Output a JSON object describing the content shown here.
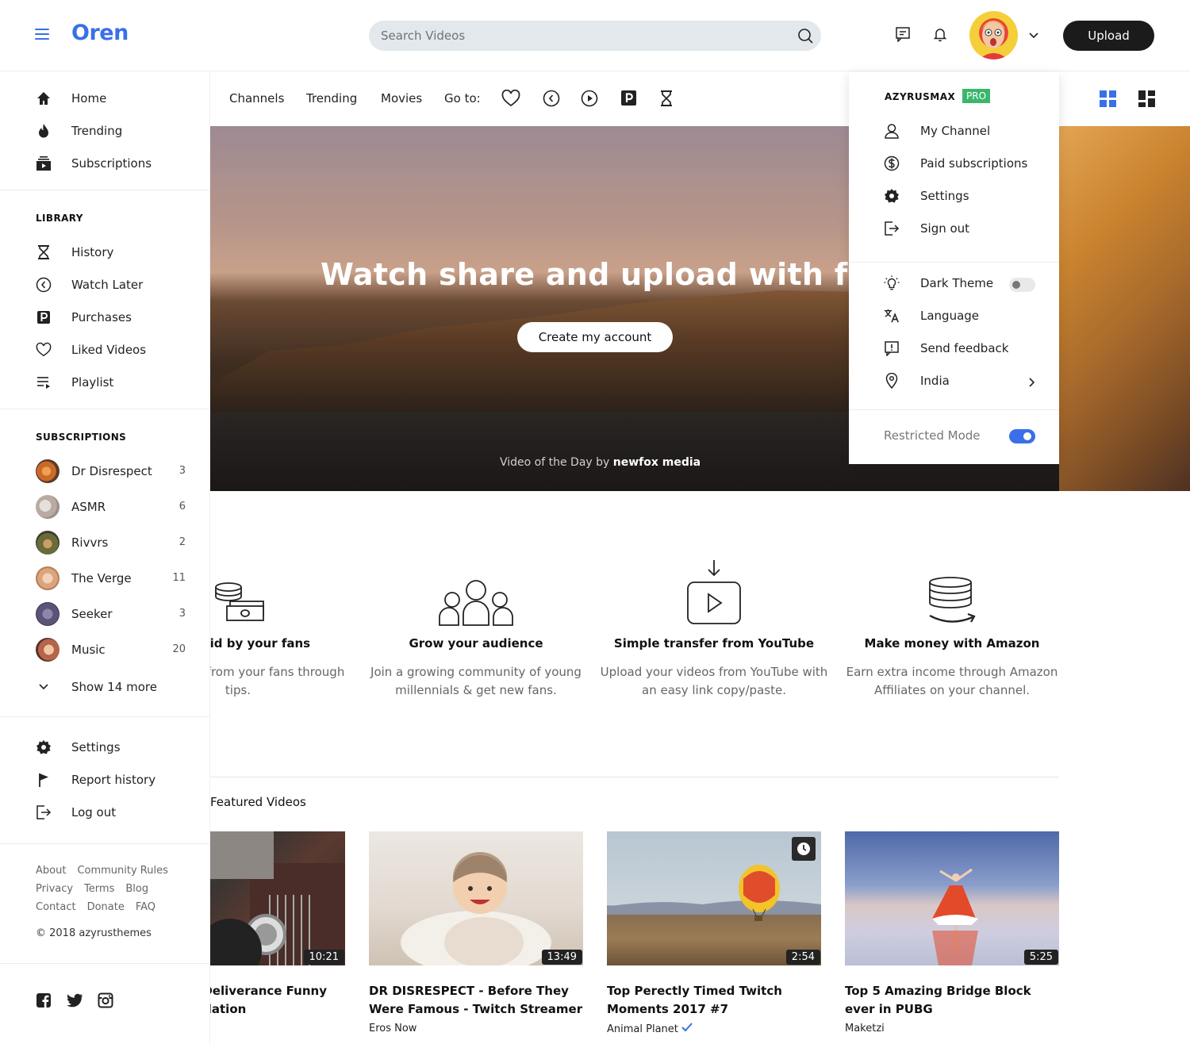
{
  "app": {
    "logo": "Oren"
  },
  "header": {
    "search_placeholder": "Search Videos",
    "upload_label": "Upload"
  },
  "colors": {
    "accent": "#3a6fe8",
    "pro_badge": "#3bb76d",
    "dark_button": "#1b1b1b"
  },
  "sidebar": {
    "main": [
      {
        "label": "Home",
        "icon": "home-icon"
      },
      {
        "label": "Trending",
        "icon": "fire-icon"
      },
      {
        "label": "Subscriptions",
        "icon": "subscriptions-icon"
      }
    ],
    "library_heading": "LIBRARY",
    "library": [
      {
        "label": "History",
        "icon": "hourglass-icon"
      },
      {
        "label": "Watch Later",
        "icon": "clock-back-icon"
      },
      {
        "label": "Purchases",
        "icon": "p-badge-icon"
      },
      {
        "label": "Liked Videos",
        "icon": "heart-icon"
      },
      {
        "label": "Playlist",
        "icon": "playlist-icon"
      }
    ],
    "subscriptions_heading": "SUBSCRIPTIONS",
    "subscriptions": [
      {
        "name": "Dr Disrespect",
        "count": "3"
      },
      {
        "name": "ASMR",
        "count": "6"
      },
      {
        "name": "Rivvrs",
        "count": "2"
      },
      {
        "name": "The Verge",
        "count": "11"
      },
      {
        "name": "Seeker",
        "count": "3"
      },
      {
        "name": "Music",
        "count": "20"
      }
    ],
    "show_more": "Show 14 more",
    "bottom": [
      {
        "label": "Settings",
        "icon": "gear-icon"
      },
      {
        "label": "Report history",
        "icon": "flag-icon"
      },
      {
        "label": "Log out",
        "icon": "logout-icon"
      }
    ],
    "footer_links": [
      [
        "About",
        "Community Rules"
      ],
      [
        "Privacy",
        "Terms",
        "Blog"
      ],
      [
        "Contact",
        "Donate",
        "FAQ"
      ]
    ],
    "copyright": "© 2018 azyrusthemes"
  },
  "nav": {
    "links": [
      "Channels",
      "Trending",
      "Movies"
    ],
    "goto_label": "Go to:"
  },
  "hero": {
    "title": "Watch share and upload with friends",
    "button": "Create my account",
    "credit_prefix": "Video of the Day by",
    "credit_name": "newfox media"
  },
  "features": [
    {
      "title": "Get paid by your fans",
      "desc": "Earn money from your fans through tips."
    },
    {
      "title": "Grow your audience",
      "desc": "Join a growing community of young millennials & get new fans."
    },
    {
      "title": "Simple transfer from YouTube",
      "desc": "Upload your videos from YouTube with an easy link copy/paste."
    },
    {
      "title": "Make money with Amazon",
      "desc": "Earn extra income through Amazon Affiliates on your channel."
    }
  ],
  "section_title": "Featured Videos",
  "videos": [
    {
      "title": "Dirt Rally: Deliverance Funny Fails Compilation",
      "channel": "",
      "duration": "10:21"
    },
    {
      "title": "DR DISRESPECT - Before They Were Famous - Twitch Streamer",
      "channel": "Eros Now",
      "duration": "13:49"
    },
    {
      "title": "Top Perectly Timed Twitch Moments 2017 #7",
      "channel": "Animal Planet",
      "duration": "2:54"
    },
    {
      "title": "Top 5 Amazing Bridge Block ever in PUBG",
      "channel": "Maketzi",
      "duration": "5:25"
    }
  ],
  "dropdown": {
    "username": "AZYRUSMAX",
    "badge": "PRO",
    "items1": [
      {
        "label": "My Channel",
        "icon": "user-icon"
      },
      {
        "label": "Paid subscriptions",
        "icon": "dollar-circle-icon"
      },
      {
        "label": "Settings",
        "icon": "gear-icon"
      },
      {
        "label": "Sign out",
        "icon": "sign-out-icon"
      }
    ],
    "items2": [
      {
        "label": "Dark Theme",
        "icon": "bulb-icon"
      },
      {
        "label": "Language",
        "icon": "translate-icon"
      },
      {
        "label": "Send feedback",
        "icon": "feedback-icon"
      },
      {
        "label": "India",
        "icon": "location-pin-icon"
      }
    ],
    "restricted_label": "Restricted Mode",
    "dark_theme_on": false,
    "restricted_on": true
  }
}
